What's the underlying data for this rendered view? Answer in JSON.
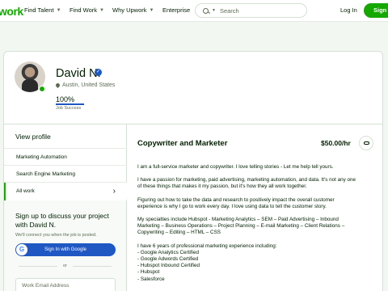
{
  "nav": {
    "logo": "work",
    "items": [
      "Find Talent",
      "Find Work",
      "Why Upwork",
      "Enterprise"
    ],
    "search_placeholder": "Search",
    "login": "Log In",
    "signup": "Sign"
  },
  "profile": {
    "name": "David N.",
    "location": "Austin, United States",
    "job_success_value": "100%",
    "job_success_label": "Job Success"
  },
  "sidebar": {
    "heading": "View profile",
    "items": [
      "Marketing Automation",
      "Search Engine Marketing",
      "All work"
    ]
  },
  "signup_box": {
    "title": "Sign up to discuss your project with David N.",
    "note": "We'll connect you when the job is posted.",
    "google": "Sign In with Google",
    "or": "or",
    "email_placeholder": "Work Email Address"
  },
  "main": {
    "title": "Copywriter and Marketer",
    "rate": "$50.00/hr",
    "paragraphs": [
      "I am a full-service marketer and copywriter. I love telling stories - Let me help tell yours.",
      "I have a passion for marketing, paid advertising, marketing automation, and data. It's not any one of these things that makes it my passion, but it's how they all work together.",
      "Figuring out how to take the data and research to positively impact the overall customer experience is why I go to work every day. I love using data to tell the customer story.",
      "My specialties include Hubspot - Marketing Analytics – SEM – Paid Advertising – Inbound Marketing – Business Operations – Project Planning – E-mail Marketing – Client Relations – Copywriting – Editing – HTML – CSS",
      "I have 6 years of professional marketing experience including:\n- Google Analytics Certified\n- Google Adwords Certified\n- Hubspot Inbound Certified\n- Hubspot\n- Salesforce"
    ]
  },
  "colors": {
    "brand": "#14a800",
    "verified": "#1f57c3"
  }
}
